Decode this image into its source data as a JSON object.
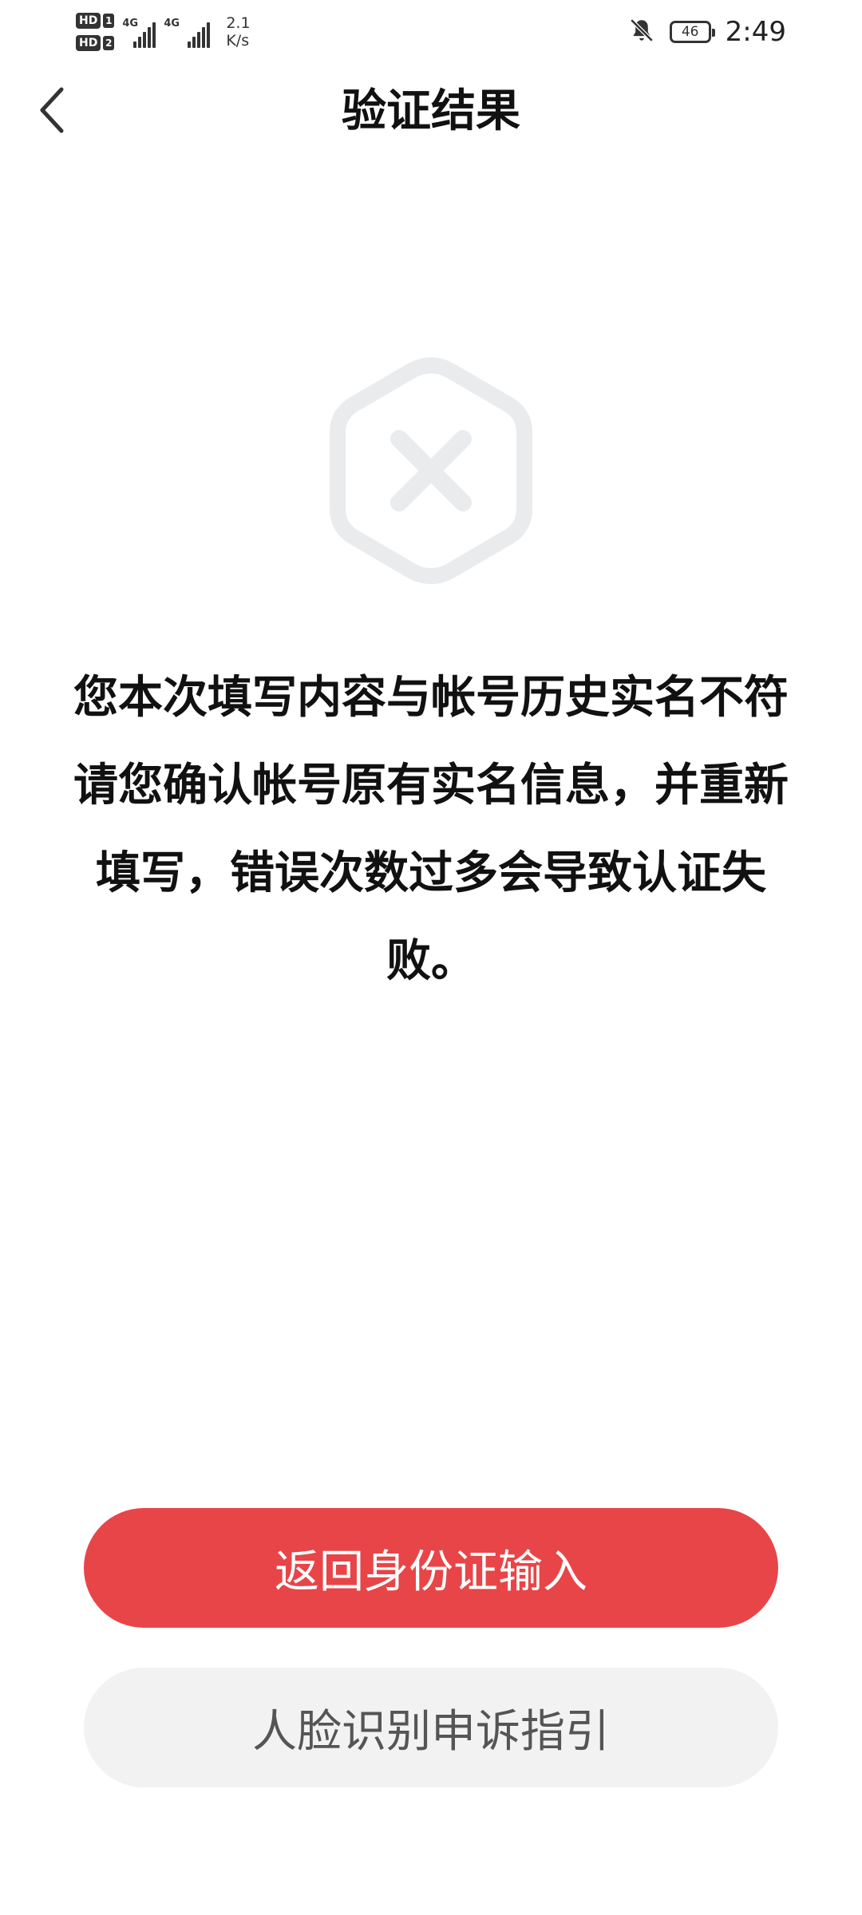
{
  "status_bar": {
    "sim1_label": "HD",
    "sim1_number": "1",
    "sim2_label": "HD",
    "sim2_number": "2",
    "network1": "4G",
    "network2": "4G",
    "speed_value": "2.1",
    "speed_unit": "K/s",
    "battery_level": "46",
    "time": "2:49",
    "icons": [
      "signal-icon",
      "silent-bell-icon",
      "battery-icon"
    ]
  },
  "header": {
    "title": "验证结果",
    "back_icon": "chevron-left-icon"
  },
  "result": {
    "icon": "hexagon-x-error-icon",
    "icon_color": "#eaebed",
    "message": "您本次填写内容与帐号历史实名不符请您确认帐号原有实名信息，并重新填写，错误次数过多会导致认证失败。"
  },
  "actions": {
    "primary_label": "返回身份证输入",
    "primary_color": "#e84548",
    "secondary_label": "人脸识别申诉指引",
    "secondary_color": "#f2f2f2"
  }
}
